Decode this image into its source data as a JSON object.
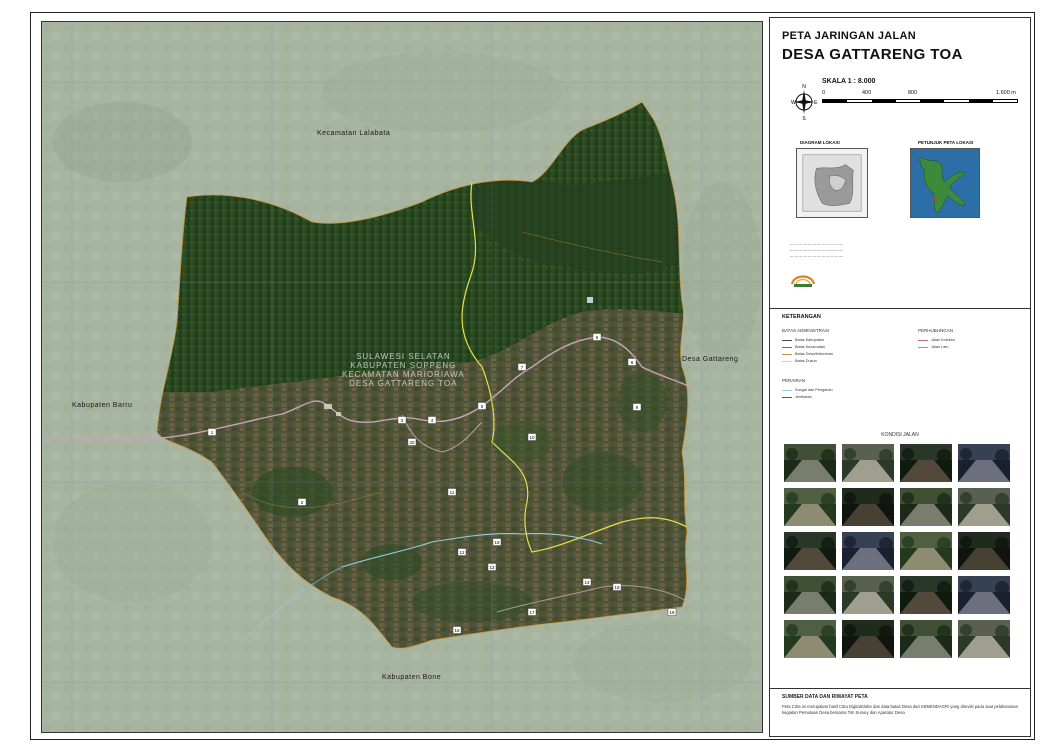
{
  "title": {
    "small": "PETA JARINGAN JALAN",
    "large": "DESA GATTARENG TOA"
  },
  "scale": {
    "label": "SKALA 1 : 8.000",
    "ticks": [
      "0",
      "400",
      "800",
      "1.600 m"
    ]
  },
  "compass": {
    "n": "N",
    "s": "S",
    "e": "E",
    "w": "W"
  },
  "insets": {
    "location_title": "DIAGRAM LOKASI",
    "guide_title": "PETUNJUK PETA LOKASI"
  },
  "map_labels": {
    "kec_lalabata": "Kecamatan Lalabata",
    "kab_barru": "Kabupaten Barru",
    "kab_bone": "Kabupaten Bone",
    "desa_gattareng": "Desa Gattareng",
    "watermark": [
      "SULAWESI SELATAN",
      "KABUPATEN SOPPENG",
      "KECAMATAN MARIORIAWA",
      "DESA GATTARENG TOA"
    ]
  },
  "road_numbers": [
    "1",
    "2",
    "3",
    "4",
    "5",
    "6",
    "7",
    "8",
    "9",
    "10",
    "11",
    "12",
    "13",
    "14",
    "15",
    "16",
    "17",
    "18",
    "19",
    "20"
  ],
  "legend": {
    "title": "KETERANGAN",
    "admin_title": "BATAS ADMINISTRASI",
    "admin": [
      {
        "label": "Batas Kabupaten",
        "color": "#444444"
      },
      {
        "label": "Batas Kecamatan",
        "color": "#b5465a"
      },
      {
        "label": "Batas Desa/Kelurahan",
        "color": "#c8913a"
      },
      {
        "label": "Batas Dusun",
        "color": "#e5e04a"
      }
    ],
    "transport_title": "PERHUBUNGAN",
    "transport": [
      {
        "label": "Jalan Kolektor",
        "color": "#b56b8a"
      },
      {
        "label": "Jalan Lain",
        "color": "#999999"
      }
    ],
    "water_title": "PERAIRAN",
    "water": [
      {
        "label": "Sungai dan Pengairan",
        "color": "#8fd0e8"
      },
      {
        "label": "Jembatan",
        "color": "#555555"
      }
    ]
  },
  "kondisi_jalan_title": "KONDISI JALAN",
  "source": {
    "title": "SUMBER DATA DAN RIWAYAT PETA",
    "text": "Peta Citra ini merupakan hasil Citra DigitalGlobe dan data batas Desa dari KEMENDAGRI yang direvisi pada saat pelaksanaan kegiatan Pemetaan Desa bersama Tim Survey dan Aparatur Desa"
  },
  "colors": {
    "forest": "#2d4a22",
    "forest_dark": "#1f3618",
    "farmland": "#5a5a3e",
    "outside": "#a9b6a2",
    "road": "#c7a4b8",
    "river": "#8fd0e8",
    "dusun": "#e5e04a"
  }
}
